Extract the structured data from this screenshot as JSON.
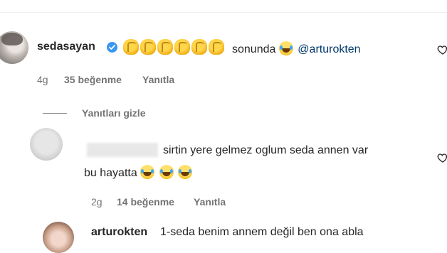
{
  "comment": {
    "username": "sedasayan",
    "text": "sonunda",
    "mention": "@arturokten",
    "time": "4g",
    "likes": "35 beğenme",
    "reply_label": "Yanıtla"
  },
  "replies_toggle": "Yanıtları gizle",
  "reply1": {
    "text_line1": "sirtin yere gelmez oglum seda annen var",
    "text_line2": "bu hayatta",
    "time": "2g",
    "likes": "14 beğenme",
    "reply_label": "Yanıtla"
  },
  "reply2": {
    "username": "arturokten",
    "text": "1-seda benim annem değil ben ona abla"
  },
  "icons": {
    "verified": "verified-badge-icon",
    "heart": "heart-outline-icon",
    "clap": "clapping-hands-emoji",
    "laugh": "tears-of-joy-emoji"
  },
  "colors": {
    "verified": "#3897f0",
    "mention": "#00376b",
    "meta": "#737373"
  }
}
